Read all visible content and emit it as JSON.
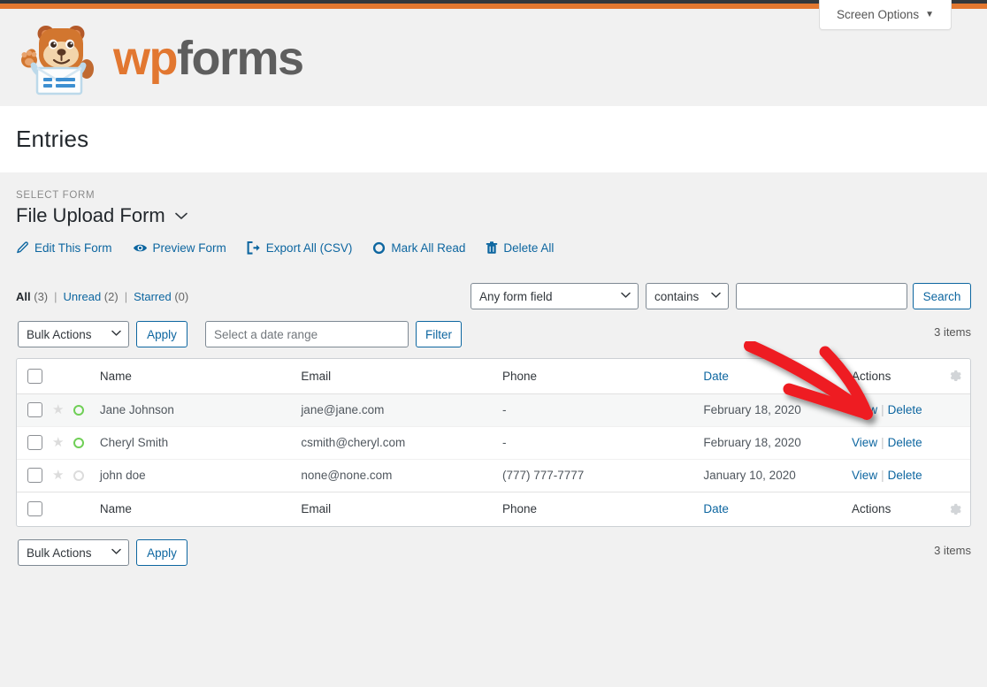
{
  "theme": {
    "admin_bar_color": "#32373c",
    "brand_orange": "#e27730",
    "link_blue": "#0d66a0",
    "page_bg": "#f1f1f1",
    "unread_green": "#6fcf56",
    "annotation_red": "#ee1c22"
  },
  "screen_options": {
    "label": "Screen Options",
    "caret": "▼"
  },
  "branding": {
    "wordmark_first": "wp",
    "wordmark_second": "forms",
    "mascot_icon": "wpforms-bear-mascot-icon"
  },
  "header": {
    "page_title": "Entries"
  },
  "form_selector": {
    "label": "SELECT FORM",
    "selected_form": "File Upload Form",
    "caret": "⌄"
  },
  "action_links": [
    {
      "label": "Edit This Form",
      "icon": "pencil-icon"
    },
    {
      "label": "Preview Form",
      "icon": "eye-icon"
    },
    {
      "label": "Export All (CSV)",
      "icon": "export-icon"
    },
    {
      "label": "Mark All Read",
      "icon": "circle-icon"
    },
    {
      "label": "Delete All",
      "icon": "trash-icon"
    }
  ],
  "status_links": {
    "all_label": "All",
    "all_count": "(3)",
    "unread_label": "Unread",
    "unread_count": "(2)",
    "starred_label": "Starred",
    "starred_count": "(0)",
    "separator": "|"
  },
  "toolbar_top": {
    "bulk_actions_label": "Bulk Actions",
    "apply_label": "Apply",
    "date_range_placeholder": "Select a date range",
    "date_range_value": "",
    "filter_label": "Filter",
    "items_count": "3 items"
  },
  "search": {
    "field_select_value": "Any form field",
    "comparison_value": "contains",
    "term_value": "",
    "term_placeholder": "",
    "search_button_label": "Search"
  },
  "table": {
    "columns": {
      "name": "Name",
      "email": "Email",
      "phone": "Phone",
      "date": "Date",
      "actions": "Actions",
      "gear_icon": "gear-icon"
    },
    "rows": [
      {
        "name": "Jane Johnson",
        "email": "jane@jane.com",
        "phone": "-",
        "date": "February 18, 2020",
        "view_label": "View",
        "delete_label": "Delete",
        "unread": true,
        "starred": false
      },
      {
        "name": "Cheryl Smith",
        "email": "csmith@cheryl.com",
        "phone": "-",
        "date": "February 18, 2020",
        "view_label": "View",
        "delete_label": "Delete",
        "unread": true,
        "starred": false
      },
      {
        "name": "john doe",
        "email": "none@none.com",
        "phone": "(777) 777-7777",
        "date": "January 10, 2020",
        "view_label": "View",
        "delete_label": "Delete",
        "unread": false,
        "starred": false
      }
    ],
    "row_action_separator": "|"
  },
  "toolbar_bottom": {
    "bulk_actions_label": "Bulk Actions",
    "apply_label": "Apply",
    "items_count": "3 items"
  },
  "annotation": {
    "type": "red-arrow",
    "points_to": "View"
  }
}
